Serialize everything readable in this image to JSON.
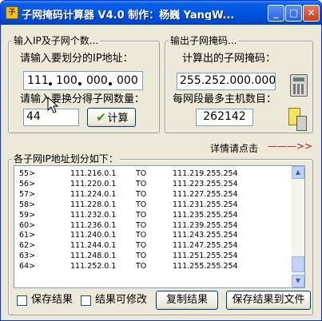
{
  "window": {
    "title": "子网掩码计算器 V4.0  制作：杨巍 YangW..."
  },
  "titlebar": {
    "app_icon": "app-icon",
    "min_glyph": "_",
    "max_glyph": "□",
    "close_glyph": "✕"
  },
  "input_group": {
    "legend": "输入IP及子网个数...",
    "ip_label": "请输入要划分的IP地址：",
    "ip": [
      "111",
      "100",
      "000",
      "000"
    ],
    "count_label": "请输入要换分得子网数量：",
    "count_value": "44",
    "calc_button": "计算"
  },
  "output_group": {
    "legend": "输出子网掩码...",
    "mask_label": "计算出的子网掩码：",
    "mask_value": "255.252.000.000",
    "hosts_label": "每网段最多主机数目：",
    "hosts_value": "262142",
    "icons": [
      "calculator-icon",
      "notepad-calculator-icon"
    ]
  },
  "details": {
    "label": "详情请点击",
    "arrow": "———>>"
  },
  "list_group": {
    "legend": "各子网IP地址划分如下：",
    "rows": [
      {
        "idx": "55>",
        "start": "111.216.0.1",
        "to": "TO",
        "end": "111.219.255.254"
      },
      {
        "idx": "56>",
        "start": "111.220.0.1",
        "to": "TO",
        "end": "111.223.255.254"
      },
      {
        "idx": "57>",
        "start": "111.224.0.1",
        "to": "TO",
        "end": "111.227.255.254"
      },
      {
        "idx": "58>",
        "start": "111.228.0.1",
        "to": "TO",
        "end": "111.231.255.254"
      },
      {
        "idx": "59>",
        "start": "111.232.0.1",
        "to": "TO",
        "end": "111.235.255.254"
      },
      {
        "idx": "60>",
        "start": "111.236.0.1",
        "to": "TO",
        "end": "111.239.255.254"
      },
      {
        "idx": "61>",
        "start": "111.240.0.1",
        "to": "TO",
        "end": "111.243.255.254"
      },
      {
        "idx": "62>",
        "start": "111.244.0.1",
        "to": "TO",
        "end": "111.247.255.254"
      },
      {
        "idx": "63>",
        "start": "111.248.0.1",
        "to": "TO",
        "end": "111.251.255.254"
      },
      {
        "idx": "64>",
        "start": "111.252.0.1",
        "to": "TO",
        "end": "111.255.255.254"
      }
    ],
    "scroll_up": "▲",
    "scroll_down": "▼"
  },
  "bottom": {
    "save_checkbox": "保存结果",
    "editable_checkbox": "结果可修改",
    "copy_button": "复制结果",
    "save_file_button": "保存结果到文件"
  },
  "colors": {
    "title_blue": "#0054e3",
    "face": "#ece9d8",
    "arrow_red": "#d01010",
    "field_border": "#7f9db9"
  }
}
